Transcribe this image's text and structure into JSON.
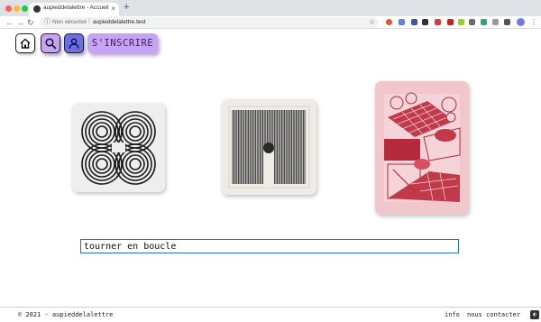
{
  "browser": {
    "tab_title": "aupieddelalettre - Accueil",
    "tab_close": "×",
    "new_tab": "+",
    "security_label": "Non sécurisé",
    "url": "aupieddelalettre.test",
    "back": "←",
    "forward": "→",
    "reload": "↻",
    "star": "☆",
    "menu": "⋮"
  },
  "nav": {
    "signup_label": "S'INSCRIRE",
    "colors": {
      "search_bg": "#c7a4ef",
      "user_bg": "#6d6de5",
      "signup_bg": "#c7a4ef"
    }
  },
  "search": {
    "value": "tourner en boucle"
  },
  "footer": {
    "copyright": "© 2021 - aupieddelalettre",
    "info": "info",
    "contact": "nous contacter"
  },
  "icons": [
    "home-icon",
    "search-icon",
    "user-icon",
    "lock-icon",
    "star-icon"
  ]
}
